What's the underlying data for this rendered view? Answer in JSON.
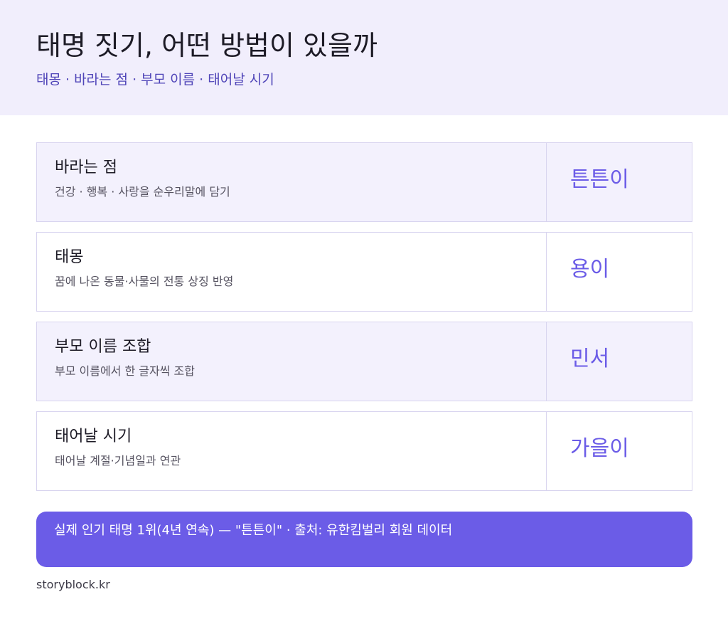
{
  "header": {
    "title": "태명 짓기, 어떤 방법이 있을까",
    "subtitle": "태몽 · 바라는 점 · 부모 이름 · 태어날 시기"
  },
  "rows": [
    {
      "label": "바라는 점",
      "description": "건강 · 행복 · 사랑을 순우리말에 담기",
      "example": "튼튼이"
    },
    {
      "label": "태몽",
      "description": "꿈에 나온 동물·사물의 전통 상징 반영",
      "example": "용이"
    },
    {
      "label": "부모 이름 조합",
      "description": "부모 이름에서 한 글자씩 조합",
      "example": "민서"
    },
    {
      "label": "태어날 시기",
      "description": "태어날 계절·기념일과 연관",
      "example": "가을이"
    }
  ],
  "banner": {
    "text": "실제 인기 태명 1위(4년 연속) — \"튼튼이\"  ·  출처: 유한킴벌리 회원 데이터"
  },
  "footer": {
    "source": "storyblock.kr"
  },
  "colors": {
    "header_bg": "#f1eefc",
    "accent": "#6b5ce7",
    "subtitle": "#4f44b8",
    "row_shaded_bg": "#f3f1fd",
    "border": "#d8d4ef"
  }
}
